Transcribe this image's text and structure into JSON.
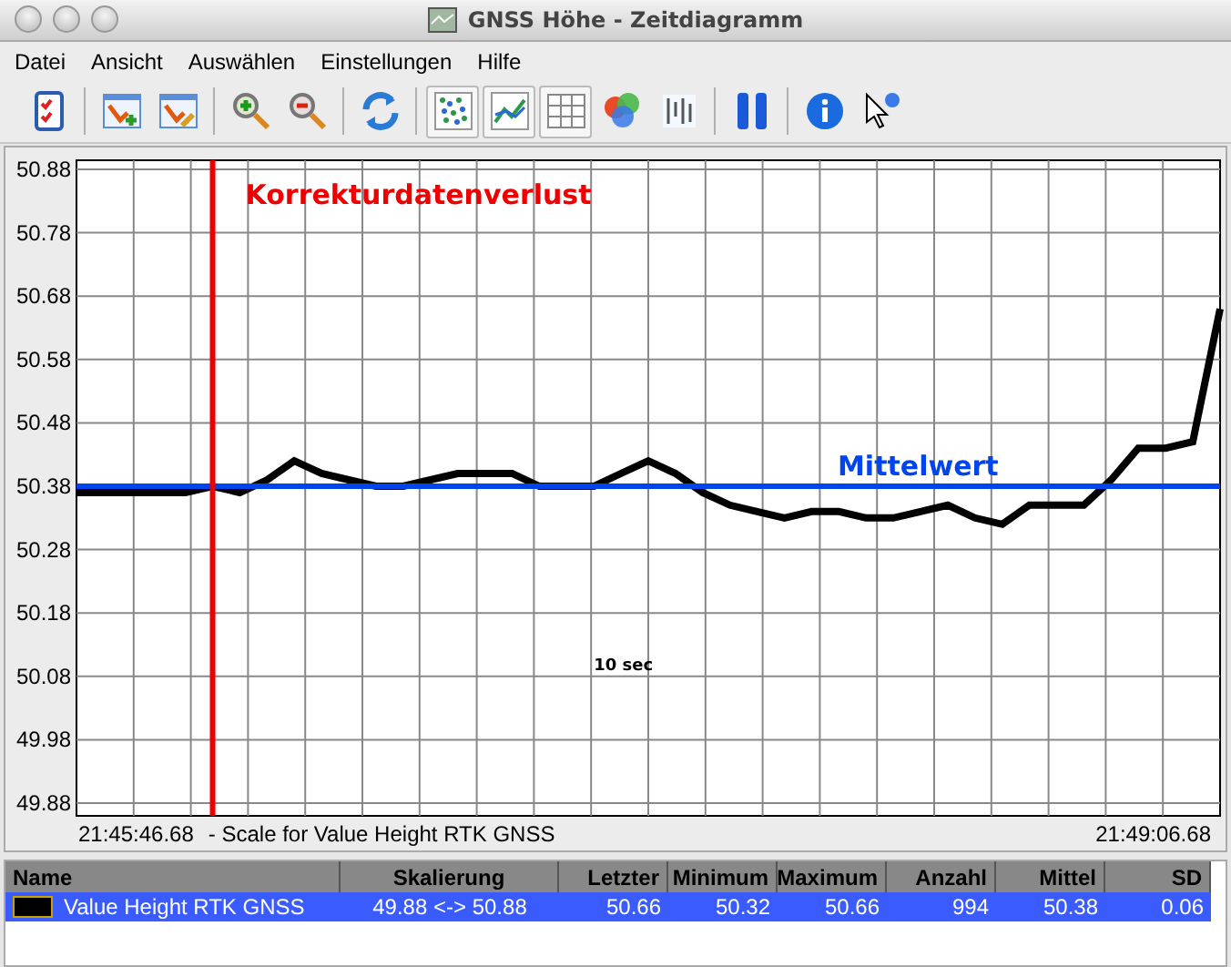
{
  "window": {
    "title": "GNSS Höhe - Zeitdiagramm"
  },
  "menu": [
    "Datei",
    "Ansicht",
    "Auswählen",
    "Einstellungen",
    "Hilfe"
  ],
  "toolbar": [
    {
      "kind": "checklist",
      "pressed": false
    },
    {
      "kind": "separator"
    },
    {
      "kind": "add-chart",
      "pressed": false
    },
    {
      "kind": "edit-chart",
      "pressed": false
    },
    {
      "kind": "separator"
    },
    {
      "kind": "zoom-in",
      "pressed": false
    },
    {
      "kind": "zoom-out",
      "pressed": false
    },
    {
      "kind": "separator"
    },
    {
      "kind": "refresh",
      "pressed": false
    },
    {
      "kind": "separator"
    },
    {
      "kind": "scatter",
      "pressed": true
    },
    {
      "kind": "line",
      "pressed": true
    },
    {
      "kind": "grid",
      "pressed": true
    },
    {
      "kind": "circles",
      "pressed": false
    },
    {
      "kind": "bars",
      "pressed": false
    },
    {
      "kind": "separator"
    },
    {
      "kind": "pause",
      "pressed": false
    },
    {
      "kind": "separator"
    },
    {
      "kind": "info",
      "pressed": false
    },
    {
      "kind": "help-pointer",
      "pressed": false
    }
  ],
  "chart": {
    "chart_data": {
      "type": "line",
      "grid": true,
      "ylim": [
        49.88,
        50.88
      ],
      "yticks": [
        {
          "value": 50.88,
          "label": "50.88"
        },
        {
          "value": 50.78,
          "label": "50.78"
        },
        {
          "value": 50.68,
          "label": "50.68"
        },
        {
          "value": 50.58,
          "label": "50.58"
        },
        {
          "value": 50.48,
          "label": "50.48"
        },
        {
          "value": 50.38,
          "label": "50.38"
        },
        {
          "value": 50.28,
          "label": "50.28"
        },
        {
          "value": 50.18,
          "label": "50.18"
        },
        {
          "value": 50.08,
          "label": "50.08"
        },
        {
          "value": 49.98,
          "label": "49.98"
        },
        {
          "value": 49.88,
          "label": "49.88"
        }
      ],
      "series": [
        {
          "color": "#000000",
          "values": [
            50.37,
            50.37,
            50.37,
            50.37,
            50.37,
            50.38,
            50.37,
            50.39,
            50.42,
            50.4,
            50.39,
            50.38,
            50.38,
            50.39,
            50.4,
            50.4,
            50.4,
            50.38,
            50.38,
            50.38,
            50.4,
            50.42,
            50.4,
            50.37,
            50.35,
            50.34,
            50.33,
            50.34,
            50.34,
            50.33,
            50.33,
            50.34,
            50.35,
            50.33,
            50.32,
            50.35,
            50.35,
            50.35,
            50.39,
            50.44,
            50.44,
            50.45,
            50.66
          ]
        }
      ],
      "ref_lines": [
        {
          "axis": "y",
          "value": 50.38,
          "color": "#0044ee",
          "label": "Mittelwert"
        }
      ],
      "annotations": [
        "10 sec"
      ]
    },
    "marker_label": "Korrekturdatenverlust",
    "start_time": "21:45:46.68",
    "caption": "-  Scale for Value Height RTK GNSS",
    "end_time": "21:49:06.68"
  },
  "table": {
    "columns": [
      "Name",
      "Skalierung",
      "Letzter",
      "Minimum",
      "Maximum",
      "Anzahl",
      "Mittel",
      "SD"
    ],
    "rows": [
      {
        "selected": true,
        "color": "#000000",
        "cells": [
          "Value Height RTK GNSS",
          "49.88 <-> 50.88",
          "50.66",
          "50.32",
          "50.66",
          "994",
          "50.38",
          "0.06"
        ]
      }
    ]
  }
}
